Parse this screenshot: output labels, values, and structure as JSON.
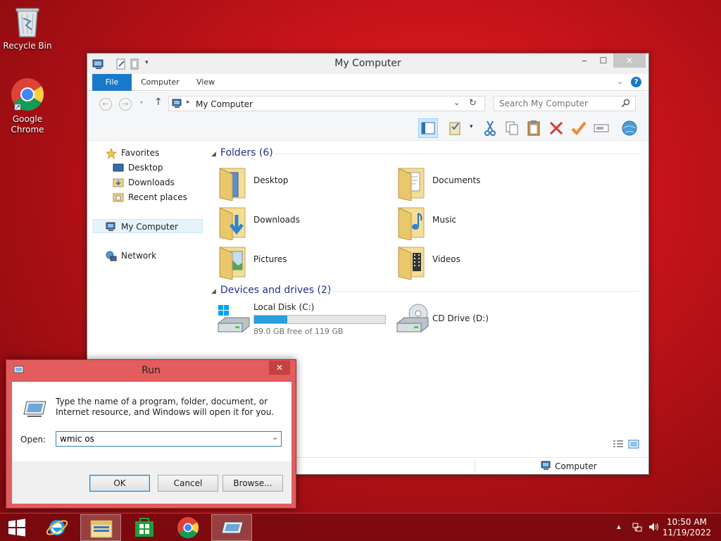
{
  "desktop": {
    "icons": [
      {
        "label": "Recycle Bin",
        "icon": "recycle-bin-icon"
      },
      {
        "label": "Google Chrome",
        "icon": "chrome-icon"
      }
    ]
  },
  "explorer": {
    "title": "My Computer",
    "tabs": {
      "file": "File",
      "computer": "Computer",
      "view": "View"
    },
    "address": "My Computer",
    "search_placeholder": "Search My Computer",
    "nav": {
      "favorites": "Favorites",
      "desktop": "Desktop",
      "downloads": "Downloads",
      "recent": "Recent places",
      "my_computer": "My Computer",
      "network": "Network"
    },
    "folders_header": "Folders (6)",
    "folders": [
      "Desktop",
      "Documents",
      "Downloads",
      "Music",
      "Pictures",
      "Videos"
    ],
    "drives_header": "Devices and drives (2)",
    "drives": [
      {
        "name": "Local Disk (C:)",
        "free": "89.0 GB free of 119 GB",
        "used_fraction": 0.25
      },
      {
        "name": "CD Drive (D:)"
      }
    ],
    "status_location": "Computer"
  },
  "run_dialog": {
    "title": "Run",
    "description": "Type the name of a program, folder, document, or Internet resource, and Windows will open it for you.",
    "open_label": "Open:",
    "open_value": "wmic os",
    "ok": "OK",
    "cancel": "Cancel",
    "browse": "Browse..."
  },
  "taskbar": {
    "time": "10:50 AM",
    "date": "11/19/2022"
  },
  "colors": {
    "accent": "#1979ca",
    "desktop_red": "#c8141a",
    "run_frame": "#e35d5e",
    "progress": "#26a0da"
  }
}
